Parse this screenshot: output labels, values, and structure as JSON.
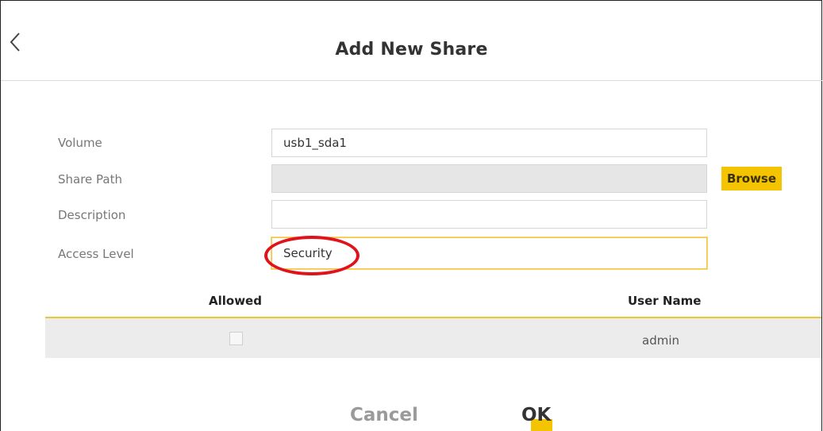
{
  "dialog": {
    "title": "Add New Share",
    "back_icon": "chevron-left-icon"
  },
  "form": {
    "volume": {
      "label": "Volume",
      "value": "usb1_sda1"
    },
    "share_path": {
      "label": "Share Path",
      "value": "",
      "browse_label": "Browse"
    },
    "description": {
      "label": "Description",
      "value": ""
    },
    "access_level": {
      "label": "Access Level",
      "value": "Security"
    }
  },
  "users_table": {
    "headers": {
      "allowed": "Allowed",
      "user_name": "User Name"
    },
    "rows": [
      {
        "allowed": false,
        "user_name": "admin"
      }
    ]
  },
  "actions": {
    "cancel_label": "Cancel",
    "ok_label": "OK"
  },
  "colors": {
    "accent": "#f5c400",
    "annotation": "#e0121b",
    "disabled_field": "#e6e6e6",
    "row_bg": "#ececec"
  }
}
